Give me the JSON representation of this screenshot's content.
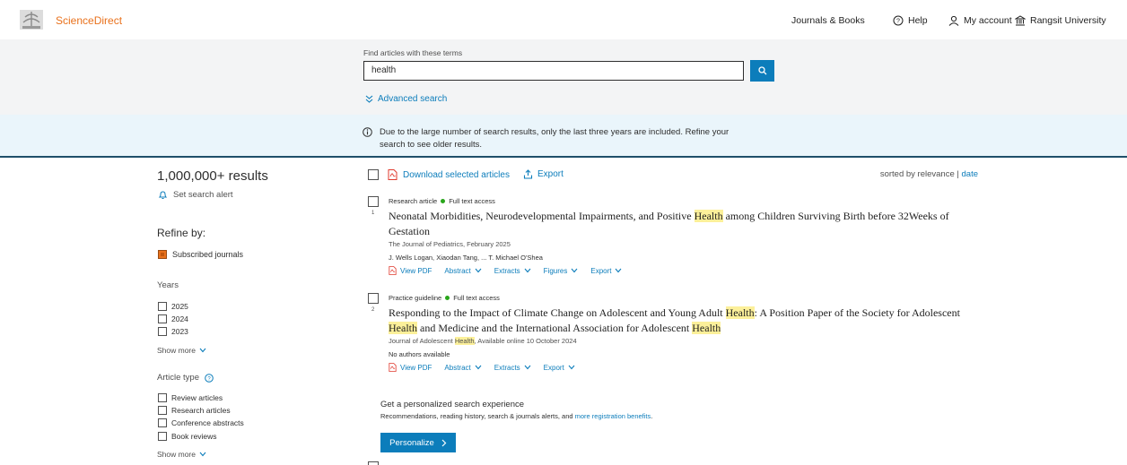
{
  "header": {
    "logo_text": "ScienceDirect",
    "nav": {
      "journals": "Journals & Books",
      "help": "Help",
      "account": "My account",
      "institution": "Rangsit University"
    }
  },
  "search": {
    "label": "Find articles with these terms",
    "value": "health",
    "advanced_label": "Advanced search"
  },
  "notice": {
    "text": "Due to the large number of search results, only the last three years are included. Refine your search to see older results."
  },
  "sidebar": {
    "results_count": "1,000,000+ results",
    "set_alert": "Set search alert",
    "refine_by": "Refine by:",
    "subscribed": "Subscribed journals",
    "years_title": "Years",
    "years": [
      "2025",
      "2024",
      "2023"
    ],
    "show_more_years": "Show more",
    "article_type_title": "Article type",
    "article_types": [
      "Review articles",
      "Research articles",
      "Conference abstracts",
      "Book reviews"
    ],
    "show_more_types": "Show more"
  },
  "toolbar": {
    "download": "Download selected articles",
    "export": "Export",
    "sorted_prefix": "sorted by relevance | ",
    "sorted_date": "date"
  },
  "results": [
    {
      "num": "1",
      "type": "Research article",
      "access": "Full text access",
      "title_a": "Neonatal Morbidities, Neurodevelopmental Impairments, and Positive ",
      "title_hl": "Health",
      "title_b": " among Children Surviving Birth before 32Weeks of Gestation",
      "journal": "The Journal of Pediatrics, February 2025",
      "authors": "J. Wells Logan, Xiaodan Tang, ... T. Michael O'Shea",
      "actions": {
        "pdf": "View PDF",
        "abstract": "Abstract",
        "extracts": "Extracts",
        "figures": "Figures",
        "export": "Export"
      }
    },
    {
      "num": "2",
      "type": "Practice guideline",
      "access": "Full text access",
      "title_a": "Responding to the Impact of Climate Change on Adolescent and Young Adult ",
      "title_hl1": "Health",
      "title_b": ": A Position Paper of the Society for Adolescent ",
      "title_hl2": "Health",
      "title_c": " and Medicine and the International Association for Adolescent ",
      "title_hl3": "Health",
      "journal_a": "Journal of Adolescent ",
      "journal_hl": "Health",
      "journal_b": ", Available online 10 October 2024",
      "authors": "No authors available",
      "actions": {
        "pdf": "View PDF",
        "abstract": "Abstract",
        "extracts": "Extracts",
        "export": "Export"
      }
    }
  ],
  "personalize": {
    "title": "Get a personalized search experience",
    "sub": "Recommendations, reading history, search & journals alerts, and ",
    "sub_link": "more registration benefits",
    "sub_end": ".",
    "button": "Personalize"
  },
  "colors": {
    "accent": "#0c7dbb",
    "brand": "#e9711c",
    "highlight": "#fcf09a"
  }
}
